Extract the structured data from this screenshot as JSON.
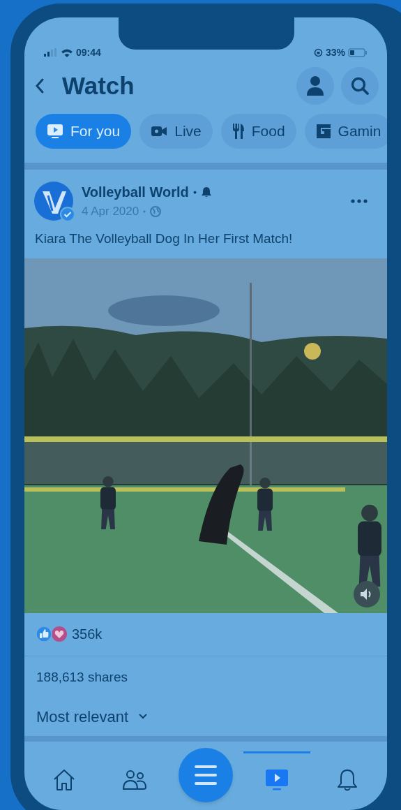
{
  "status_bar": {
    "time": "09:44",
    "battery": "33%"
  },
  "header": {
    "title": "Watch"
  },
  "tabs": [
    {
      "kind": "for-you",
      "label": "For you",
      "selected": true
    },
    {
      "kind": "live",
      "label": "Live",
      "selected": false
    },
    {
      "kind": "food",
      "label": "Food",
      "selected": false
    },
    {
      "kind": "gaming",
      "label": "Gamin",
      "selected": false
    }
  ],
  "post": {
    "author": "Volleyball World",
    "date": "4 Apr 2020",
    "caption": "Kiara The Volleyball Dog In Her First Match!",
    "reactions": "356k",
    "shares": "188,613 shares",
    "sort": "Most relevant"
  },
  "nav": [
    {
      "kind": "home",
      "selected": false
    },
    {
      "kind": "friends",
      "selected": false
    },
    {
      "kind": "menu",
      "selected": false
    },
    {
      "kind": "watch",
      "selected": true
    },
    {
      "kind": "notifications",
      "selected": false
    }
  ]
}
